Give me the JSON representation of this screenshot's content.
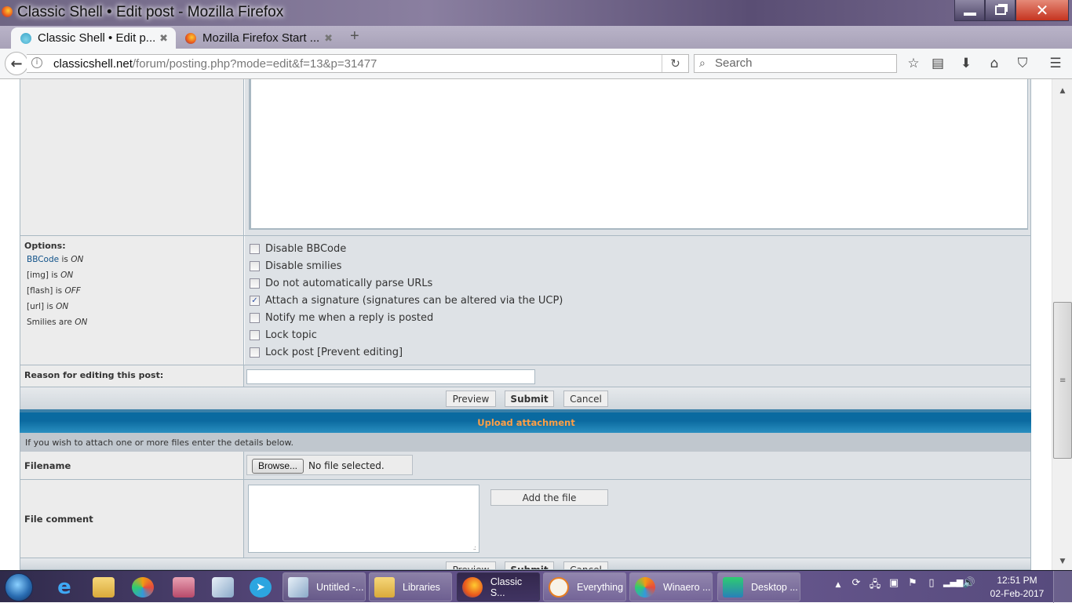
{
  "window": {
    "title": "Classic Shell • Edit post - Mozilla Firefox",
    "controls": {
      "minimize": "minimize",
      "maximize": "restore",
      "close": "close"
    }
  },
  "browser": {
    "tabs": [
      {
        "label": "Classic Shell • Edit p...",
        "icon": "classic-shell-icon",
        "active": true
      },
      {
        "label": "Mozilla Firefox Start ...",
        "icon": "firefox-icon",
        "active": false
      }
    ],
    "new_tab": "+",
    "url_domain": "classicshell.net",
    "url_path": "/forum/posting.php?mode=edit&f=13&p=31477",
    "search_placeholder": "Search",
    "toolbar_icons": [
      "bookmark-star-icon",
      "reading-list-icon",
      "downloads-icon",
      "home-icon",
      "pocket-icon",
      "menu-icon"
    ]
  },
  "form": {
    "options": {
      "title": "Options:",
      "status": [
        {
          "prefix": "",
          "link": "BBCode",
          "middle": " is ",
          "value": "ON"
        },
        {
          "prefix": "[img]",
          "link": "",
          "middle": " is ",
          "value": "ON"
        },
        {
          "prefix": "[flash]",
          "link": "",
          "middle": " is ",
          "value": "OFF"
        },
        {
          "prefix": "[url]",
          "link": "",
          "middle": " is ",
          "value": "ON"
        },
        {
          "prefix": "Smilies",
          "link": "",
          "middle": " are ",
          "value": "ON"
        }
      ],
      "checkboxes": [
        {
          "label": "Disable BBCode",
          "checked": false
        },
        {
          "label": "Disable smilies",
          "checked": false
        },
        {
          "label": "Do not automatically parse URLs",
          "checked": false
        },
        {
          "label": "Attach a signature (signatures can be altered via the UCP)",
          "checked": true
        },
        {
          "label": "Notify me when a reply is posted",
          "checked": false
        },
        {
          "label": "Lock topic",
          "checked": false
        },
        {
          "label": "Lock post [Prevent editing]",
          "checked": false
        }
      ]
    },
    "reason_label": "Reason for editing this post:",
    "reason_value": "",
    "buttons": {
      "preview": "Preview",
      "submit": "Submit",
      "cancel": "Cancel"
    }
  },
  "upload": {
    "heading": "Upload attachment",
    "description": "If you wish to attach one or more files enter the details below.",
    "filename_label": "Filename",
    "browse_label": "Browse...",
    "no_file_text": "No file selected.",
    "file_comment_label": "File comment",
    "file_comment_value": "",
    "add_file_label": "Add the file"
  },
  "taskbar": {
    "pinned": [
      "internet-explorer-icon",
      "file-explorer-icon",
      "winaero-icon",
      "registry-security-icon",
      "notepad-icon",
      "telegram-icon"
    ],
    "buttons": [
      {
        "label": "Untitled -...",
        "icon": "notepad-icon",
        "active": false
      },
      {
        "label": "Libraries",
        "icon": "folder-icon",
        "active": false
      },
      {
        "label": "Classic S...",
        "icon": "firefox-icon",
        "active": true
      },
      {
        "label": "Everything",
        "icon": "everything-search-icon",
        "active": false
      },
      {
        "label": "Winaero ...",
        "icon": "winaero-icon",
        "active": false
      },
      {
        "label": "Desktop ...",
        "icon": "desktop-icon",
        "active": false
      }
    ],
    "tray_icons": [
      "show-hidden-icons",
      "sync-icon",
      "network-globe-icon",
      "windows-update-icon",
      "action-center-flag-icon",
      "power-plug-icon",
      "signal-bars-icon",
      "volume-icon"
    ],
    "time": "12:51 PM",
    "date": "02-Feb-2017"
  }
}
